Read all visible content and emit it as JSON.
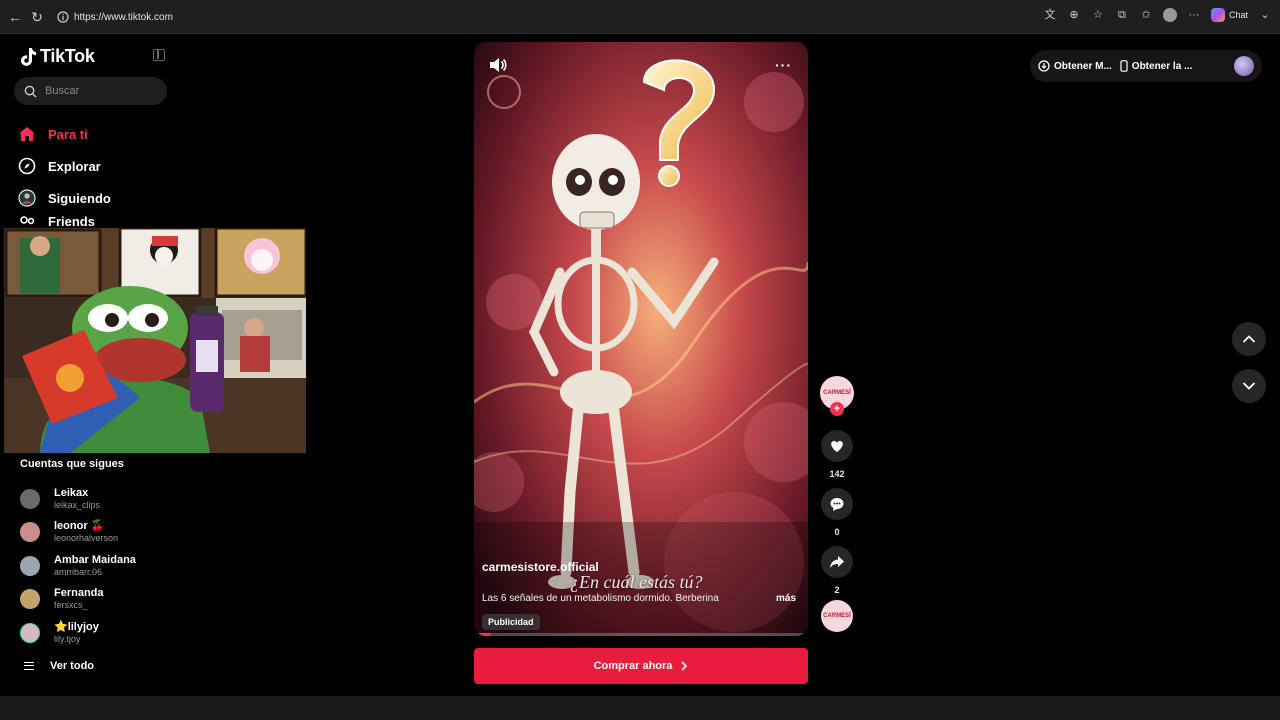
{
  "browser": {
    "url": "https://www.tiktok.com",
    "chat_label": "Chat"
  },
  "sidebar": {
    "logo_text": "TikTok",
    "search_placeholder": "Buscar",
    "nav_items": [
      {
        "label": "Para ti",
        "icon": "home-icon",
        "active": true
      },
      {
        "label": "Explorar",
        "icon": "compass-icon",
        "active": false
      },
      {
        "label": "Siguiendo",
        "icon": "following-icon",
        "active": false
      },
      {
        "label": "Friends",
        "icon": "friends-icon",
        "active": false
      }
    ],
    "following_title": "Cuentas que sigues",
    "following": [
      {
        "name": "Leikax",
        "handle": "leikax_clips",
        "avatar_color": "#6b6b6b"
      },
      {
        "name": "leonor 🍒",
        "handle": "leonorhalverson",
        "avatar_color": "#c98f8a"
      },
      {
        "name": "Ambar Maidana",
        "handle": "ammbarr.06",
        "avatar_color": "#9aa6b2"
      },
      {
        "name": "Fernanda",
        "handle": "fersxcs_",
        "avatar_color": "#c6a26a"
      },
      {
        "name": "⭐lilyjoy",
        "handle": "lily.tjoy",
        "avatar_color": "#d8b8c0"
      }
    ],
    "see_all": "Ver todo"
  },
  "video": {
    "username": "carmesistore.official",
    "subtitle": "¿En cuál estás tú?",
    "description": "Las 6 señales de un metabolismo dormido. Berberina",
    "more": "más",
    "ad_badge": "Publicidad",
    "progress": 0.05,
    "cta_label": "Comprar ahora"
  },
  "actions": {
    "brand_avatar_text": "CARMESÍ",
    "likes": "142",
    "comments": "0",
    "shares": "2"
  },
  "topright": {
    "get_pc": "Obtener M...",
    "get_app": "Obtener la ..."
  },
  "colors": {
    "accent": "#fe2c55",
    "cta": "#e81d3e"
  }
}
